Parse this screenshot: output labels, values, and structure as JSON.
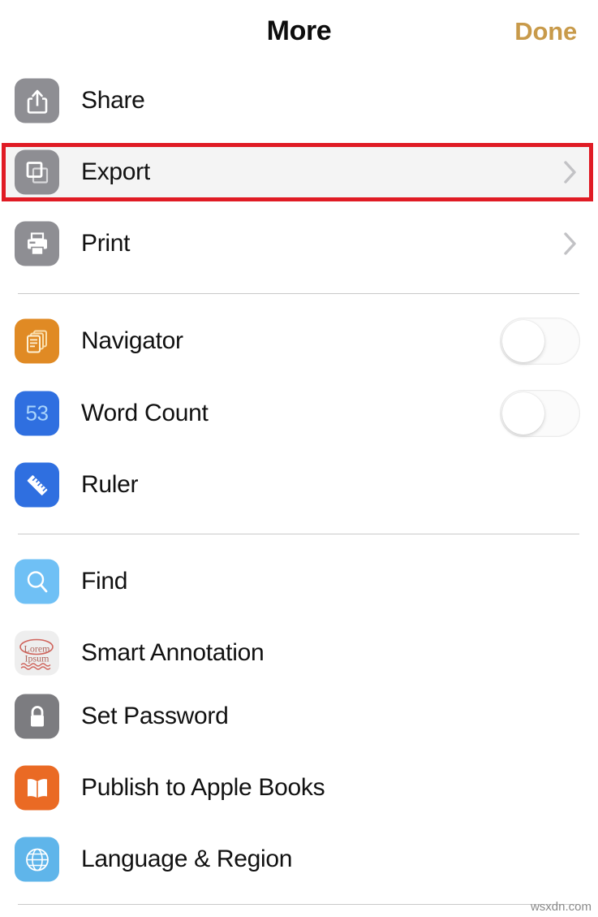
{
  "header": {
    "title": "More",
    "done_label": "Done"
  },
  "accent_colors": {
    "done": "#c89a4a",
    "highlight_border": "#e01b24",
    "highlight_fill": "#f4f4f4",
    "gray_icon": "#8e8e93",
    "orange_navigator": "#e08a24",
    "blue_wordcount": "#2f6fe0",
    "blue_ruler": "#2f6fe0",
    "lightblue_find": "#6fc0f5",
    "smart_annotation_bg": "#eeeeee",
    "lock_gray": "#7c7c80",
    "books_orange": "#ea6a24",
    "globe_blue": "#5fb5ea"
  },
  "sections": [
    {
      "name": "document-actions",
      "items": [
        {
          "label": "Share",
          "icon": "share-icon",
          "accessory": "none",
          "highlighted": false
        },
        {
          "label": "Export",
          "icon": "export-icon",
          "accessory": "chevron",
          "highlighted": true
        },
        {
          "label": "Print",
          "icon": "print-icon",
          "accessory": "chevron",
          "highlighted": false
        }
      ]
    },
    {
      "name": "view-tools",
      "items": [
        {
          "label": "Navigator",
          "icon": "navigator-icon",
          "accessory": "toggle",
          "toggle_on": false,
          "highlighted": false
        },
        {
          "label": "Word Count",
          "icon": "word-count-icon",
          "icon_text": "53",
          "accessory": "toggle",
          "toggle_on": false,
          "highlighted": false
        },
        {
          "label": "Ruler",
          "icon": "ruler-icon",
          "accessory": "none",
          "highlighted": false
        }
      ]
    },
    {
      "name": "document-settings",
      "items": [
        {
          "label": "Find",
          "icon": "find-icon",
          "accessory": "none",
          "highlighted": false
        },
        {
          "label": "Smart Annotation",
          "icon": "smart-annotation-icon",
          "icon_text_top": "Lorem",
          "icon_text_bottom": "Ipsum",
          "accessory": "none",
          "highlighted": false
        },
        {
          "label": "Set Password",
          "icon": "lock-icon",
          "accessory": "none",
          "highlighted": false
        },
        {
          "label": "Publish to Apple Books",
          "icon": "books-icon",
          "accessory": "none",
          "highlighted": false
        },
        {
          "label": "Language & Region",
          "icon": "globe-icon",
          "accessory": "none",
          "highlighted": false
        }
      ]
    }
  ],
  "watermark": "wsxdn.com"
}
